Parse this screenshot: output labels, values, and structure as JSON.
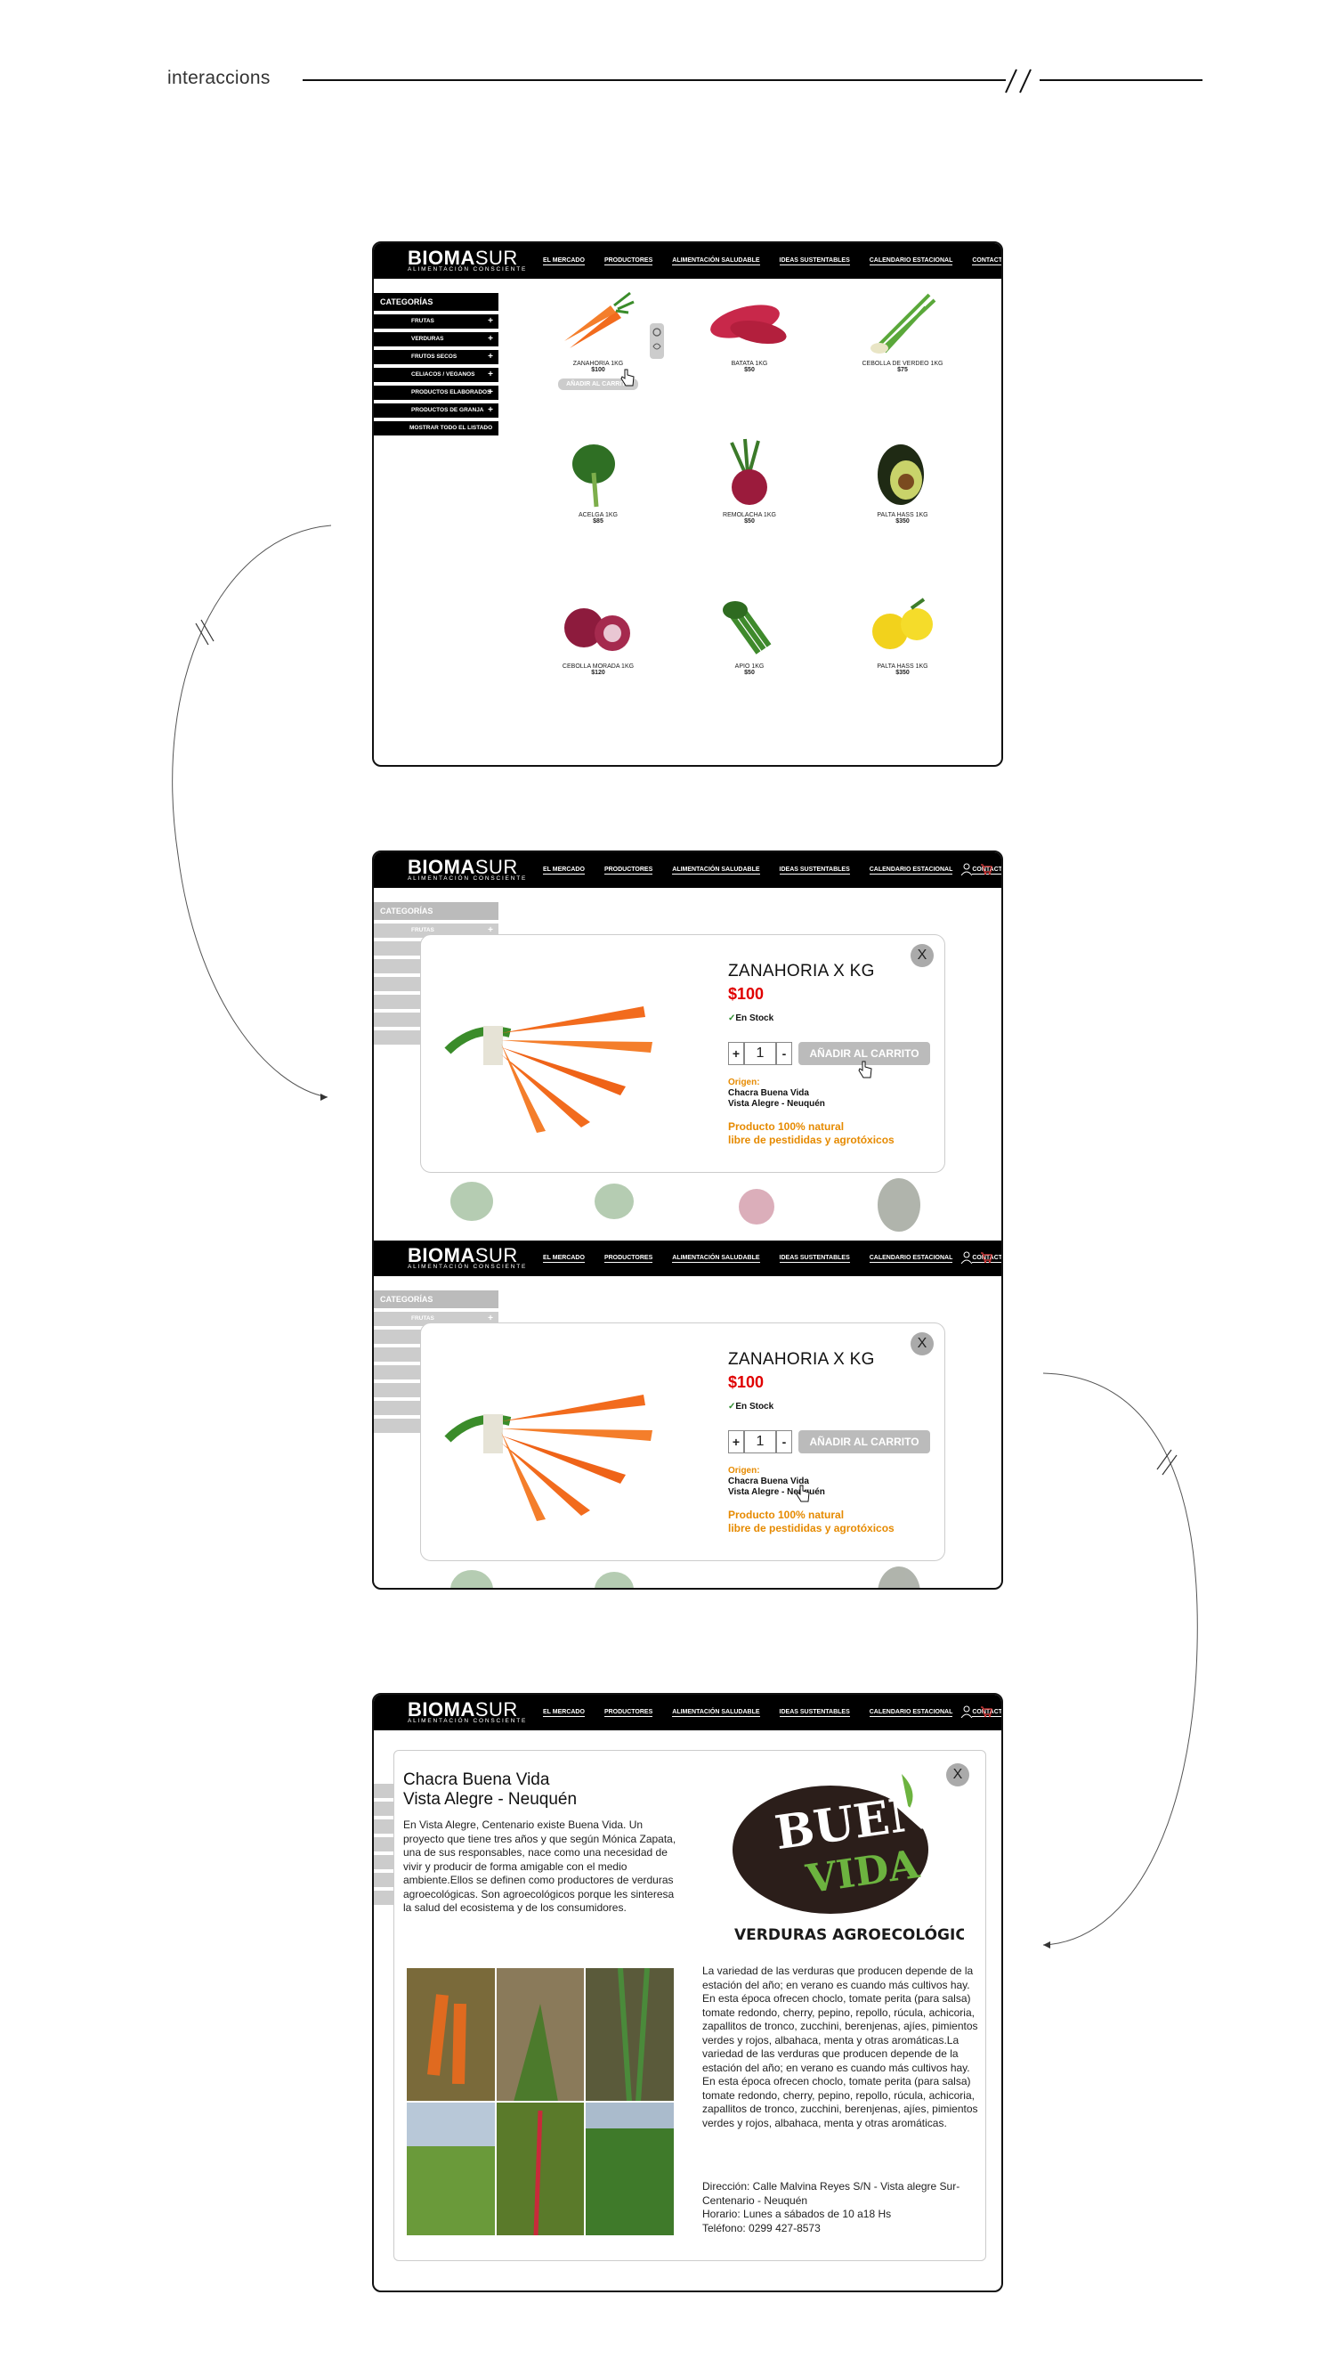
{
  "page": {
    "title": "interaccions"
  },
  "brand": {
    "name_bold": "BIOMA",
    "name_light": "SUR",
    "tagline": "ALIMENTACIÓN CONSCIENTE"
  },
  "nav": [
    "EL MERCADO",
    "PRODUCTORES",
    "ALIMENTACIÓN SALUDABLE",
    "IDEAS SUSTENTABLES",
    "CALENDARIO ESTACIONAL",
    "CONTACTO"
  ],
  "categories": {
    "title": "CATEGORÍAS",
    "items": [
      "FRUTAS",
      "VERDURAS",
      "FRUTOS SECOS",
      "CELIACOS / VEGANOS",
      "PRODUCTOS ELABORADOS",
      "PRODUCTOS DE GRANJA",
      "MOSTRAR TODO EL LISTADO"
    ]
  },
  "products": [
    {
      "name": "ZANAHORIA 1KG",
      "price": "$100",
      "icon": "carrot"
    },
    {
      "name": "BATATA 1KG",
      "price": "$50",
      "icon": "sweet-potato"
    },
    {
      "name": "CEBOLLA DE VERDEO 1KG",
      "price": "$75",
      "icon": "spring-onion"
    },
    {
      "name": "ACELGA 1KG",
      "price": "$85",
      "icon": "chard"
    },
    {
      "name": "REMOLACHA 1KG",
      "price": "$50",
      "icon": "beetroot"
    },
    {
      "name": "PALTA HASS 1KG",
      "price": "$350",
      "icon": "avocado"
    },
    {
      "name": "CEBOLLA MORADA 1KG",
      "price": "$120",
      "icon": "red-onion"
    },
    {
      "name": "APIO 1KG",
      "price": "$50",
      "icon": "celery"
    },
    {
      "name": "PALTA HASS 1KG",
      "price": "$350",
      "icon": "yellow-fruit"
    }
  ],
  "hover_button": "AÑADIR AL CARRITO",
  "modal": {
    "close": "X",
    "name": "ZANAHORIA X KG",
    "price": "$100",
    "stock": "En Stock",
    "qty": "1",
    "plus": "+",
    "minus": "-",
    "add_button": "AÑADIR AL CARRITO",
    "origin_label": "Origen:",
    "origin_line1": "Chacra Buena Vida",
    "origin_line2": "Vista Alegre - Neuquén",
    "natural_line1": "Producto 100% natural",
    "natural_line2": "libre de pestididas y agrotóxicos"
  },
  "producer": {
    "title_line1": "Chacra Buena Vida",
    "title_line2": "Vista Alegre - Neuquén",
    "intro": "En Vista Alegre, Centenario existe Buena Vida. Un proyecto que tiene tres años y que según Mónica Zapata, una de sus responsables, nace como una necesidad de vivir y producir de forma amigable con el medio ambiente.Ellos se definen como productores de verduras agroecológicas. Son agroecológicos porque les sinteresa la salud del ecosistema y de los consumidores.",
    "logo_line1": "BUENA",
    "logo_line2": "VIDA",
    "logo_sub": "VERDURAS AGROECOLÓGICAS",
    "body": "La variedad de las verduras que producen depende de la estación del año; en verano es cuando más cultivos hay. En esta época ofrecen choclo, tomate perita (para salsa) tomate redondo, cherry, pepino, repollo, rúcula, achicoria, zapallitos de tronco, zucchini, berenjenas, ajíes, pimientos verdes y rojos, albahaca, menta y otras aromáticas.La variedad de las verduras que producen depende de la estación del año; en verano es cuando más cultivos hay. En esta época ofrecen choclo, tomate perita (para salsa) tomate redondo, cherry, pepino, repollo, rúcula, achicoria, zapallitos de tronco, zucchini, berenjenas, ajíes, pimientos verdes y rojos, albahaca, menta y otras aromáticas.",
    "address": "Dirección: Calle Malvina Reyes S/N - Vista alegre Sur-Centenario - Neuquén",
    "hours": "Horario: Lunes a sábados de 10 a18 Hs",
    "phone": "Teléfono: 0299 427-8573"
  },
  "colors": {
    "accent_orange": "#e68a00",
    "price_red": "#e00000",
    "nav_black": "#000000",
    "button_gray": "#bbbbbb"
  }
}
